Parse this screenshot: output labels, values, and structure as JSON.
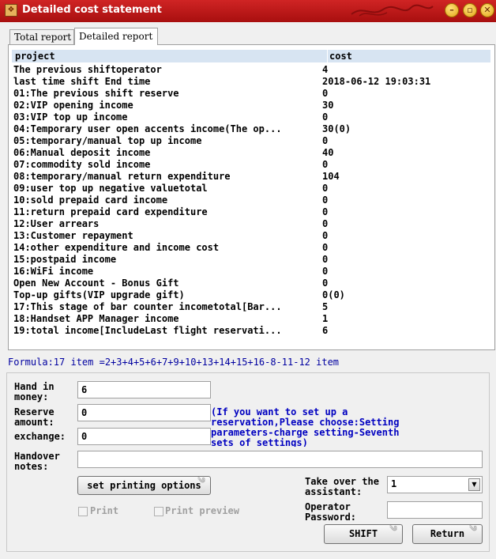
{
  "window": {
    "title": "Detailed cost statement",
    "icon": "app-icon",
    "controls": [
      "minimize",
      "maximize",
      "close"
    ]
  },
  "tabs": [
    {
      "label": "Total report",
      "active": false
    },
    {
      "label": "Detailed report",
      "active": true
    }
  ],
  "table": {
    "columns": [
      "project",
      "cost"
    ],
    "rows": [
      {
        "project": "The previous shiftoperator",
        "cost": "4"
      },
      {
        "project": "last time shift End time",
        "cost": "2018-06-12 19:03:31"
      },
      {
        "project": "01:The previous shift reserve",
        "cost": "0"
      },
      {
        "project": "02:VIP opening income",
        "cost": "30"
      },
      {
        "project": "03:VIP top up income",
        "cost": "0"
      },
      {
        "project": "04:Temporary user open accents income(The op...",
        "cost": "30(0)"
      },
      {
        "project": "05:temporary/manual top up income",
        "cost": "0"
      },
      {
        "project": "06:Manual deposit income",
        "cost": "40"
      },
      {
        "project": "07:commodity sold income",
        "cost": "0"
      },
      {
        "project": "08:temporary/manual return expenditure",
        "cost": "104"
      },
      {
        "project": "09:user top up negative valuetotal",
        "cost": "0"
      },
      {
        "project": "10:sold prepaid card  income",
        "cost": "0"
      },
      {
        "project": "11:return  prepaid card  expenditure",
        "cost": "0"
      },
      {
        "project": "12:User arrears",
        "cost": "0"
      },
      {
        "project": "13:Customer repayment",
        "cost": "0"
      },
      {
        "project": "14:other expenditure and income cost",
        "cost": "0"
      },
      {
        "project": "15:postpaid income",
        "cost": "0"
      },
      {
        "project": "16:WiFi income",
        "cost": "0"
      },
      {
        "project": "Open New Account - Bonus Gift",
        "cost": "0"
      },
      {
        "project": "Top-up gifts(VIP upgrade gift)",
        "cost": "0(0)"
      },
      {
        "project": "17:This stage of bar counter incometotal[Bar...",
        "cost": "5"
      },
      {
        "project": "18:Handset APP Manager income",
        "cost": "1"
      },
      {
        "project": "19:total income[IncludeLast flight reservati...",
        "cost": "6"
      }
    ]
  },
  "formula": "Formula:17 item =2+3+4+5+6+7+9+10+13+14+15+16-8-11-12 item",
  "form": {
    "hand_in_money": {
      "label_line1": "Hand in",
      "label_line2": "money:",
      "value": "6"
    },
    "reserve_amount": {
      "label_line1": "Reserve",
      "label_line2": "amount:",
      "value": "0"
    },
    "exchange": {
      "label": "exchange:",
      "value": "0"
    },
    "hint_lines": [
      "(If you want to set up a",
      "reservation,Please choose:Setting",
      "parameters-charge setting-Seventh",
      "sets of settings)"
    ],
    "handover_notes": {
      "label_line1": "Handover",
      "label_line2": "notes:",
      "value": ""
    },
    "set_printing_options": "set printing options",
    "print": {
      "label": "Print",
      "checked": false
    },
    "print_preview": {
      "label": "Print preview",
      "checked": false
    },
    "take_over_assistant": {
      "label_line1": "Take over the",
      "label_line2": "assistant:",
      "value": "1"
    },
    "operator_password": {
      "label_line1": "Operator",
      "label_line2": "Password:",
      "value": ""
    },
    "shift_button": "SHIFT",
    "return_button": "Return"
  },
  "colors": {
    "titlebar": "#c01818",
    "header_bg": "#d7e4f2",
    "formula_text": "#0000a0",
    "hint_text": "#0000c0"
  }
}
